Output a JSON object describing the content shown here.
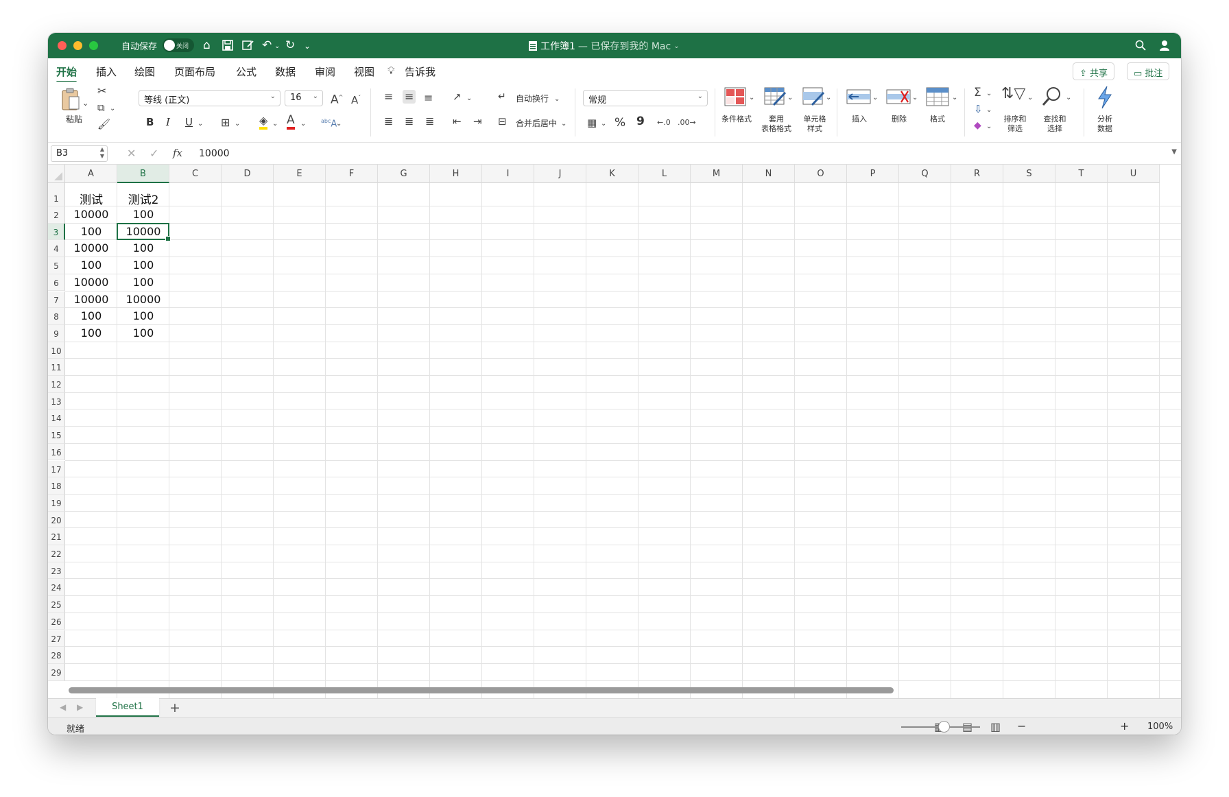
{
  "window": {
    "autosave_label": "自动保存",
    "autosave_state": "关闭",
    "doc_title": "工作簿1",
    "doc_subtitle": "— 已保存到我的 Mac",
    "accent_color": "#1e7145"
  },
  "menu": {
    "tabs": [
      "开始",
      "插入",
      "绘图",
      "页面布局",
      "公式",
      "数据",
      "审阅",
      "视图"
    ],
    "tell_me": "告诉我",
    "share": "共享",
    "comments": "批注"
  },
  "ribbon": {
    "paste": "粘贴",
    "font_name": "等线 (正文)",
    "font_size": "16",
    "bold": "B",
    "italic": "I",
    "underline": "U",
    "wrap_text": "自动换行",
    "merge_center": "合并后居中",
    "number_format": "常规",
    "percent": "%",
    "comma": "9",
    "conditional_format": "条件格式",
    "format_as_table_1": "套用",
    "format_as_table_2": "表格格式",
    "cell_styles_1": "单元格",
    "cell_styles_2": "样式",
    "insert": "插入",
    "delete": "删除",
    "format": "格式",
    "sort_filter_1": "排序和",
    "sort_filter_2": "筛选",
    "find_select_1": "查找和",
    "find_select_2": "选择",
    "analyze_1": "分析",
    "analyze_2": "数据"
  },
  "formula_bar": {
    "name_box": "B3",
    "fx": "fx",
    "value": "10000"
  },
  "grid": {
    "columns": [
      "A",
      "B",
      "C",
      "D",
      "E",
      "F",
      "G",
      "H",
      "I",
      "J",
      "K",
      "L",
      "M",
      "N",
      "O",
      "P",
      "Q",
      "R",
      "S",
      "T",
      "U"
    ],
    "rows": [
      "1",
      "2",
      "3",
      "4",
      "5",
      "6",
      "7",
      "8",
      "9",
      "10",
      "11",
      "12",
      "13",
      "14",
      "15",
      "16",
      "17",
      "18",
      "19",
      "20",
      "21",
      "22",
      "23",
      "24",
      "25",
      "26",
      "27",
      "28",
      "29"
    ],
    "selected_cell": "B3",
    "cells": [
      [
        "测试",
        "测试2"
      ],
      [
        "10000",
        "100"
      ],
      [
        "100",
        "10000"
      ],
      [
        "10000",
        "100"
      ],
      [
        "100",
        "100"
      ],
      [
        "10000",
        "100"
      ],
      [
        "10000",
        "10000"
      ],
      [
        "100",
        "100"
      ],
      [
        "100",
        "100"
      ]
    ]
  },
  "sheets": {
    "tabs": [
      "Sheet1"
    ],
    "add": "+"
  },
  "status": {
    "ready": "就绪",
    "zoom": "100%",
    "zoom_minus": "−",
    "zoom_plus": "+"
  }
}
